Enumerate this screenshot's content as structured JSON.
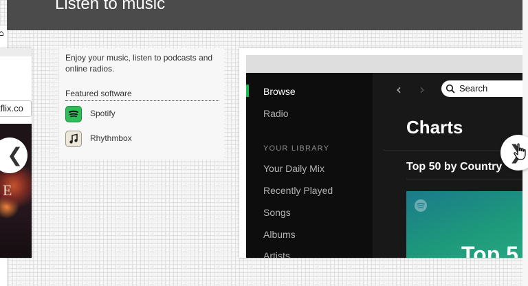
{
  "window": {
    "title": "Listen to music"
  },
  "background_preview": {
    "url_fragment": "tflix.co",
    "image_letter": "E"
  },
  "description": {
    "text": "Enjoy your music, listen to podcasts and online radios.",
    "featured_heading": "Featured software",
    "software": [
      {
        "name": "Spotify",
        "icon": "spotify-icon"
      },
      {
        "name": "Rhythmbox",
        "icon": "rhythmbox-icon"
      }
    ]
  },
  "carousel": {
    "prev_glyph": "❮",
    "next_glyph": "❯"
  },
  "spotify_screenshot": {
    "nav": [
      {
        "label": "Browse",
        "active": true
      },
      {
        "label": "Radio",
        "active": false
      }
    ],
    "library_heading": "YOUR LIBRARY",
    "library": [
      "Your Daily Mix",
      "Recently Played",
      "Songs",
      "Albums",
      "Artists"
    ],
    "back_glyph": "‹",
    "forward_glyph": "›",
    "search_label": "Search",
    "page_title": "Charts",
    "section_title": "Top 50 by Country",
    "card_text": "Top 5",
    "accent_color": "#1db954"
  }
}
